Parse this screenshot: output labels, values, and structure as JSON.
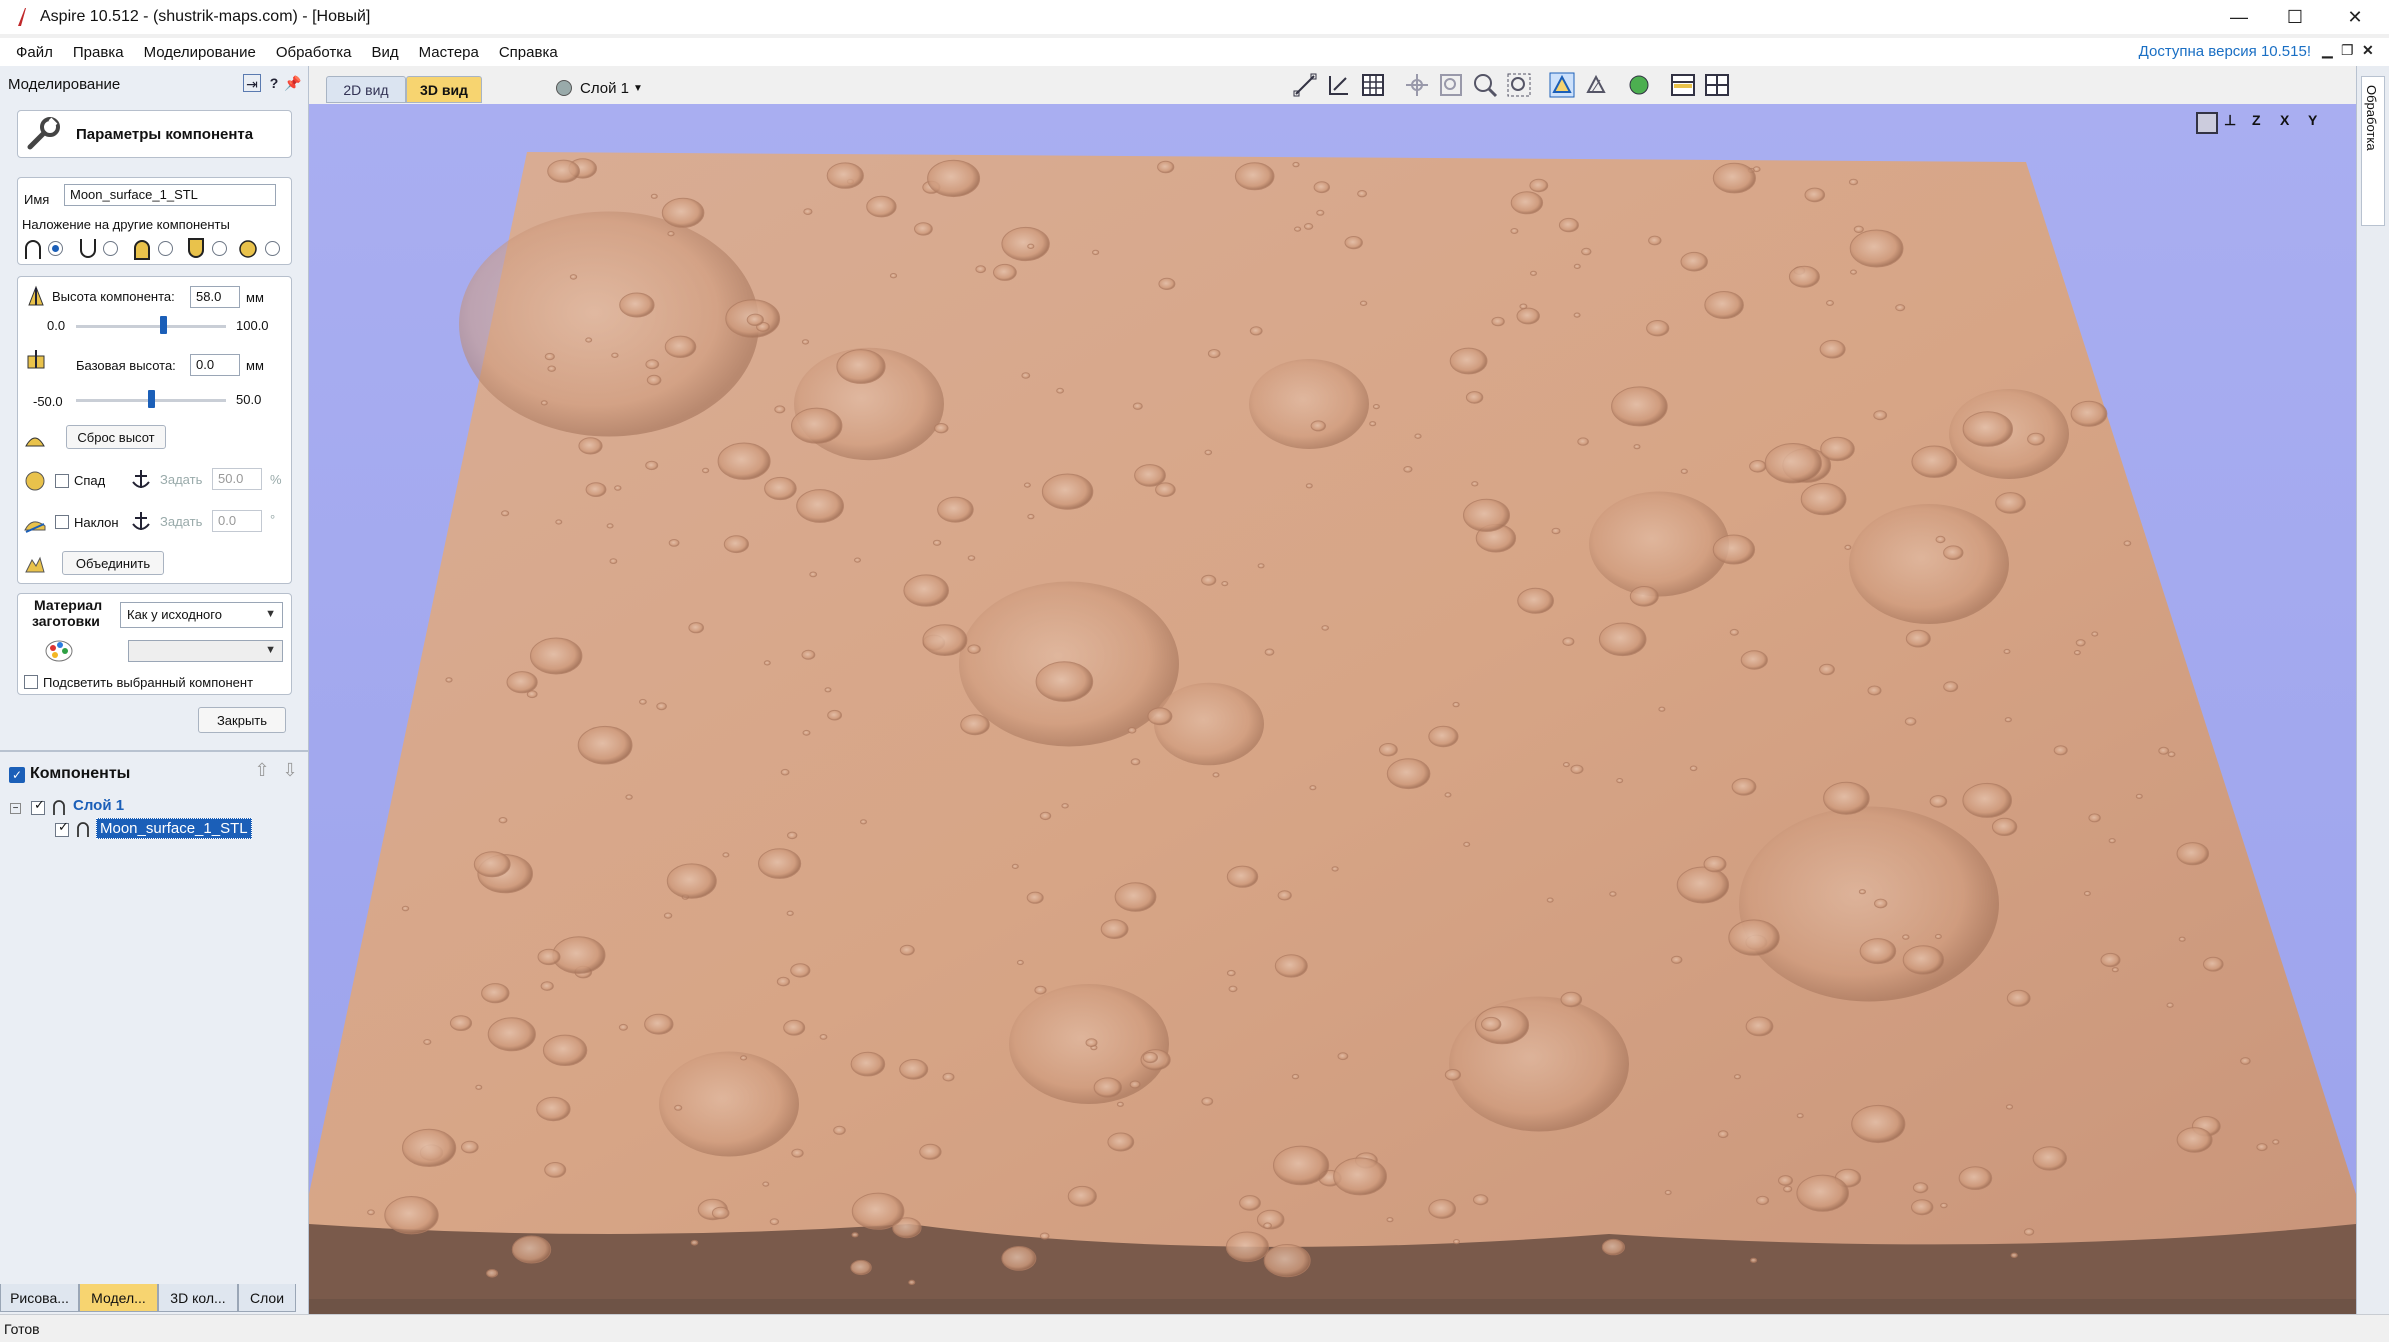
{
  "titlebar": {
    "title": "Aspire 10.512 - (shustrik-maps.com) - [Новый]",
    "minimize": "—",
    "maximize": "☐",
    "close": "✕"
  },
  "menu": {
    "items": [
      "Файл",
      "Правка",
      "Моделирование",
      "Обработка",
      "Вид",
      "Мастера",
      "Справка"
    ],
    "update_notice": "Доступна версия 10.515!"
  },
  "panel": {
    "header_title": "Моделирование",
    "pin_help": "?",
    "params_title": "Параметры компонента",
    "name_label": "Имя",
    "name_value": "Moon_surface_1_STL",
    "overlay_label": "Наложение на другие компоненты",
    "height_label": "Высота компонента:",
    "height_value": "58.0",
    "height_unit": "мм",
    "height_min": "0.0",
    "height_max": "100.0",
    "height_level": 0.58,
    "base_label": "Базовая высота:",
    "base_value": "0.0",
    "base_unit": "мм",
    "base_min": "-50.0",
    "base_max": "50.0",
    "base_level": 0.5,
    "reset_label": "Сброс высот",
    "fade_label": "Спад",
    "set_label": "Задать",
    "fade_value": "50.0",
    "fade_unit": "%",
    "tilt_label": "Наклон",
    "tilt_value": "0.0",
    "tilt_unit": "°",
    "merge_label": "Объединить",
    "material_label_1": "Материал",
    "material_label_2": "заготовки",
    "material_select": "Как у исходного",
    "highlight_label": "Подсветить выбранный компонент",
    "close_label": "Закрыть"
  },
  "components": {
    "header": "Компоненты",
    "layer_name": "Слой 1",
    "item_name": "Moon_surface_1_STL"
  },
  "bottom_tabs": [
    "Рисова...",
    "Модел...",
    "3D кол...",
    "Слои"
  ],
  "views": {
    "tab_2d": "2D вид",
    "tab_3d": "3D вид",
    "layer": "Слой 1"
  },
  "right_rail": {
    "tab_label": "Обработка"
  },
  "status": {
    "text": "Готов"
  },
  "colors": {
    "accent": "#1b5fb8",
    "active_tab": "#f7d470",
    "viewport_bg": "#a3a9ee",
    "terrain": "#d9a88a"
  }
}
